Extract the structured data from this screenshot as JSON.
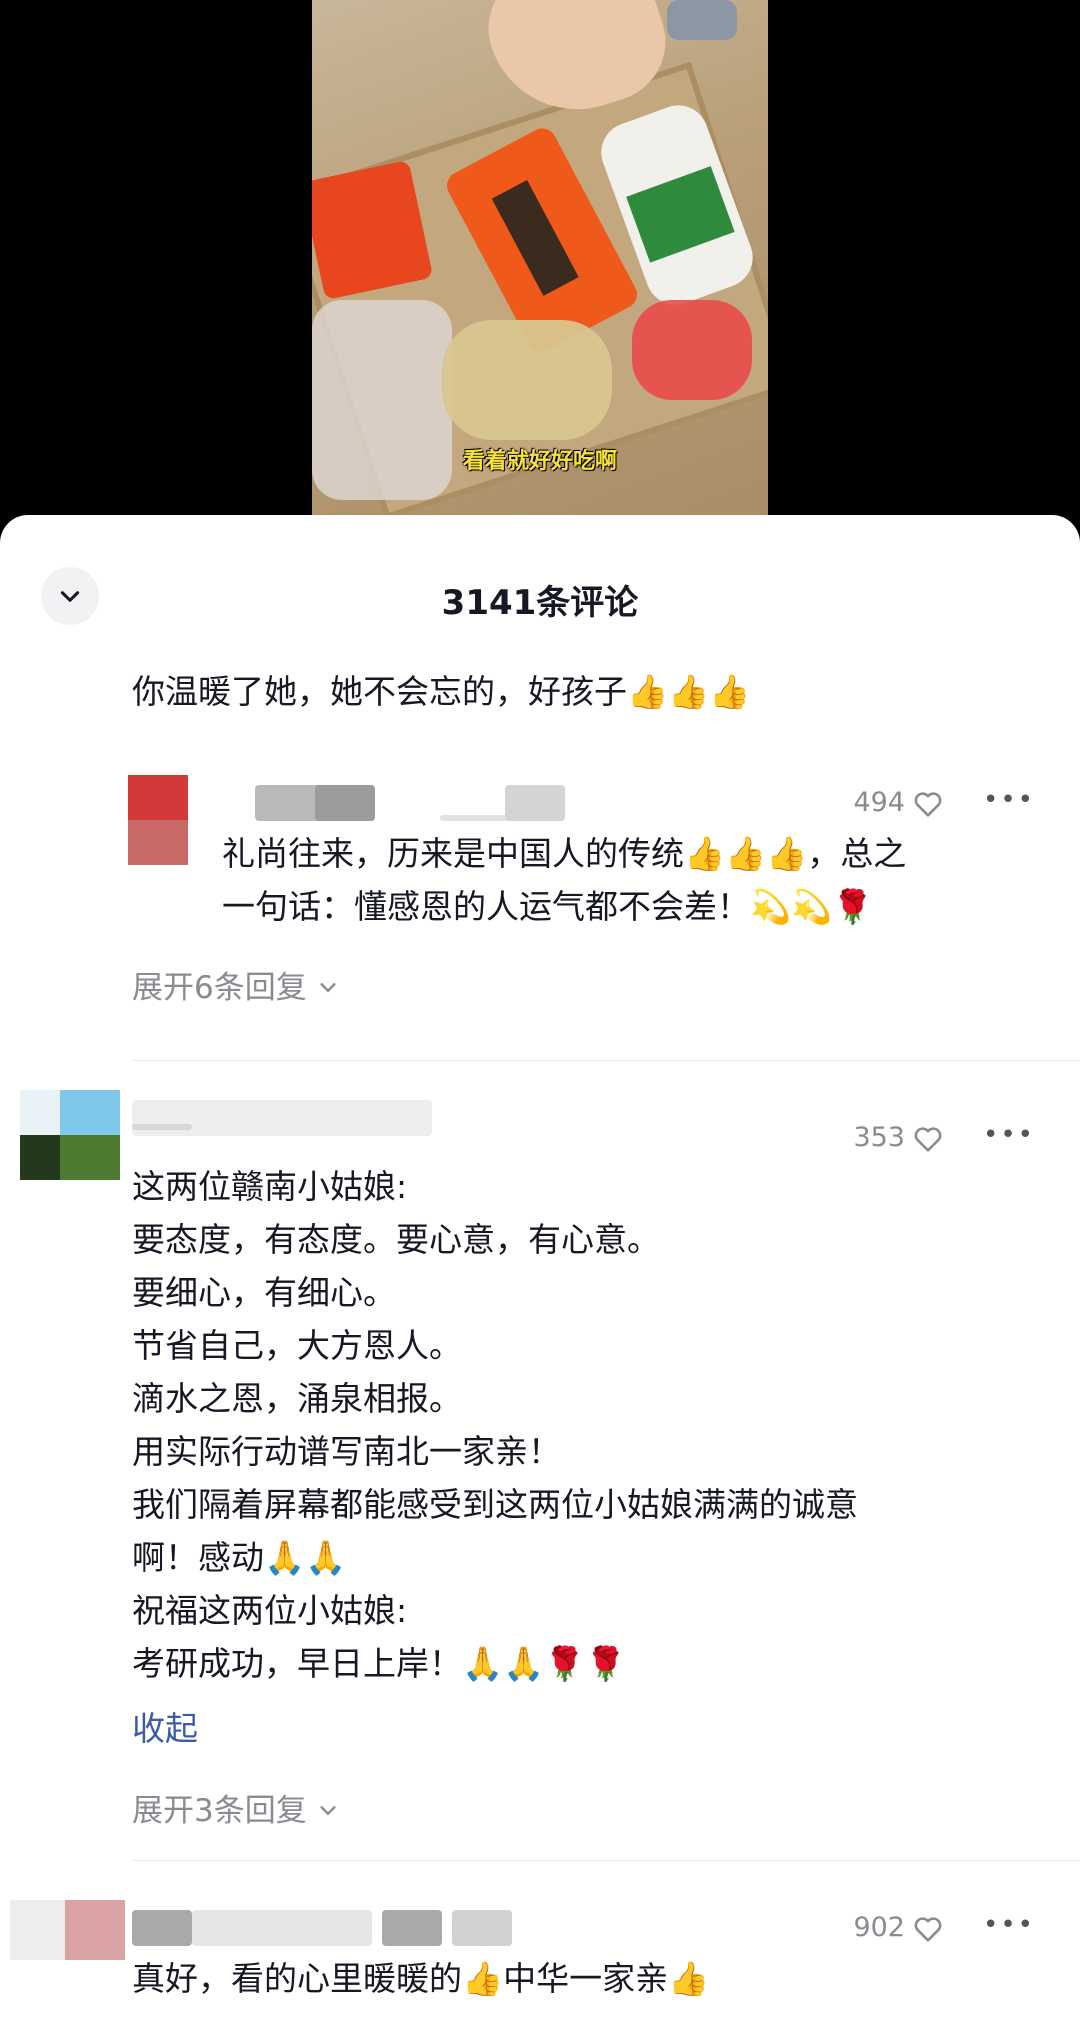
{
  "video": {
    "caption": "看着就好好吃啊"
  },
  "header": {
    "title": "3141条评论"
  },
  "comments": [
    {
      "text": "你温暖了她，她不会忘的，好孩子👍👍👍"
    },
    {
      "likes": "494",
      "text": "礼尚往来，历来是中国人的传统👍👍👍，总之\n一句话：懂感恩的人运气都不会差！💫💫🌹",
      "expand": "展开6条回复"
    },
    {
      "likes": "353",
      "text": "这两位赣南小姑娘:\n要态度，有态度。要心意，有心意。\n要细心，有细心。\n节省自己，大方恩人。\n滴水之恩，涌泉相报。\n用实际行动谱写南北一家亲！\n我们隔着屏幕都能感受到这两位小姑娘满满的诚意\n啊！感动🙏🙏\n祝福这两位小姑娘:\n考研成功，早日上岸！🙏🙏🌹🌹",
      "collapse": "收起",
      "expand": "展开3条回复"
    },
    {
      "likes": "902",
      "text": "真好，看的心里暖暖的👍中华一家亲👍"
    }
  ],
  "icons": {
    "collapse": "chevron-down-icon",
    "like": "heart-outline-icon",
    "more": "more-dots-icon"
  },
  "colors": {
    "link": "#3a5ca6",
    "secondary_text": "#8a8b91"
  }
}
